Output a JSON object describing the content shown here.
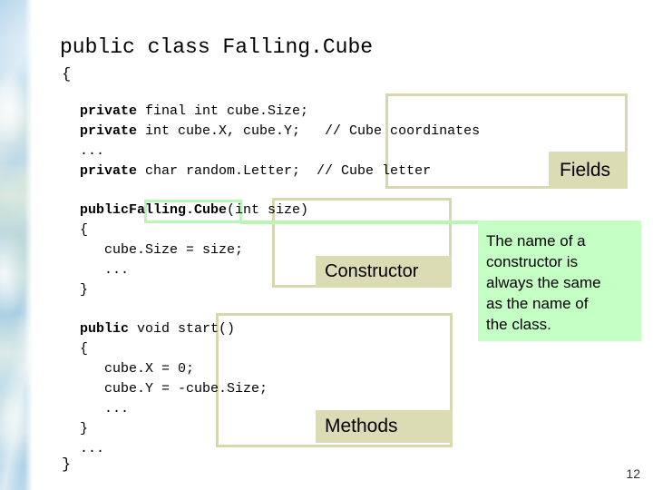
{
  "slide": {
    "page_number": "12",
    "colors": {
      "annotation_border": "#d8d8b0",
      "annotation_tab_fill": "#dcdcb4",
      "callout_fill": "#c4ffc4",
      "highlight_green": "#b6f7b6",
      "code_text": "#000000",
      "background": "#ffffff"
    }
  },
  "code": {
    "class_declaration": "public class Falling.Cube",
    "open_brace": "{",
    "close_brace": "}",
    "fields_block": [
      {
        "keyword": "private",
        "rest": " final int cube.Size;"
      },
      {
        "keyword": "private",
        "rest": " int cube.X, cube.Y;   // Cube coordinates"
      },
      {
        "keyword": "",
        "rest": "..."
      },
      {
        "keyword": "private",
        "rest": " char random.Letter;  // Cube letter"
      }
    ],
    "constructor_block": [
      {
        "keyword": "public",
        "rest": " Falling.Cube(int size)",
        "bold_name": "Falling.Cube"
      },
      {
        "keyword": "",
        "rest": "{"
      },
      {
        "keyword": "",
        "rest": "   cube.Size = size;"
      },
      {
        "keyword": "",
        "rest": "   ..."
      },
      {
        "keyword": "",
        "rest": "}"
      }
    ],
    "methods_block": [
      {
        "keyword": "public",
        "rest": " void start()"
      },
      {
        "keyword": "",
        "rest": "{"
      },
      {
        "keyword": "",
        "rest": "   cube.X = 0;"
      },
      {
        "keyword": "",
        "rest": "   cube.Y = -cube.Size;"
      },
      {
        "keyword": "",
        "rest": "   ..."
      },
      {
        "keyword": "",
        "rest": "}"
      },
      {
        "keyword": "",
        "rest": "..."
      }
    ],
    "trailing_ellipsis": "..."
  },
  "annotations": {
    "fields_label": "Fields",
    "constructor_label": "Constructor",
    "methods_label": "Methods"
  },
  "callout": {
    "line1": "The name of a",
    "line2": "constructor is",
    "line3": "always the same",
    "line4": "as the name of",
    "line5": "the class."
  }
}
